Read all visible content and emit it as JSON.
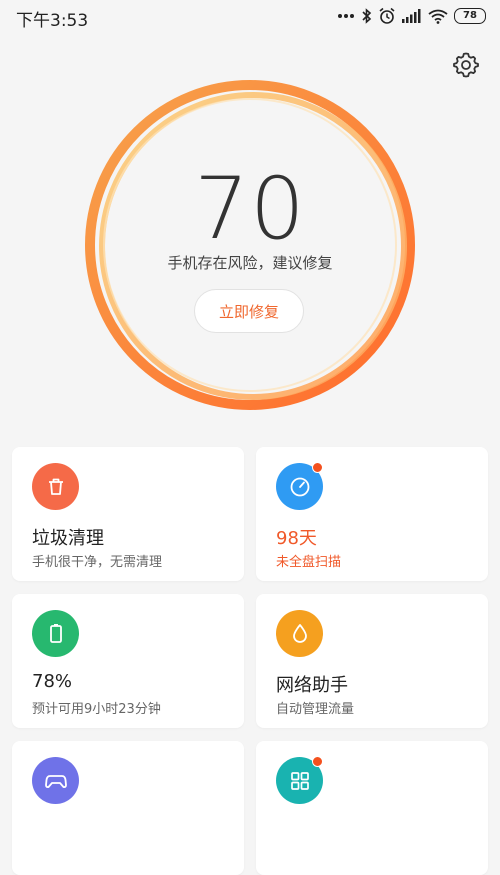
{
  "status_bar": {
    "time": "下午3:53",
    "battery": "78",
    "icons": [
      "more-dots-icon",
      "bluetooth-icon",
      "alarm-icon",
      "signal-icon",
      "wifi-icon",
      "battery-icon"
    ]
  },
  "header": {
    "settings_icon": "gear-icon"
  },
  "score": {
    "value": "70",
    "description": "手机存在风险，建议修复",
    "fix_button": "立即修复",
    "ring_colors": [
      "#f7a04a",
      "#ff6a2a"
    ]
  },
  "cards": [
    {
      "icon": "trash-icon",
      "color": "#f56a48",
      "title": "垃圾清理",
      "subtitle": "手机很干净，无需清理",
      "badge": false,
      "warn": false
    },
    {
      "icon": "security-scan-icon",
      "color": "#2f9bf3",
      "title": "98天",
      "subtitle": "未全盘扫描",
      "badge": true,
      "warn": true
    },
    {
      "icon": "battery-icon",
      "color": "#27b86f",
      "title": "78%",
      "subtitle": "预计可用9小时23分钟",
      "badge": false,
      "warn": false
    },
    {
      "icon": "water-drop-icon",
      "color": "#f5a01f",
      "title": "网络助手",
      "subtitle": "自动管理流量",
      "badge": false,
      "warn": false
    },
    {
      "icon": "gamepad-icon",
      "color": "#6f72e8",
      "title": "",
      "subtitle": "",
      "badge": false,
      "warn": false
    },
    {
      "icon": "apps-grid-icon",
      "color": "#19b3b0",
      "title": "",
      "subtitle": "",
      "badge": true,
      "warn": false
    }
  ]
}
